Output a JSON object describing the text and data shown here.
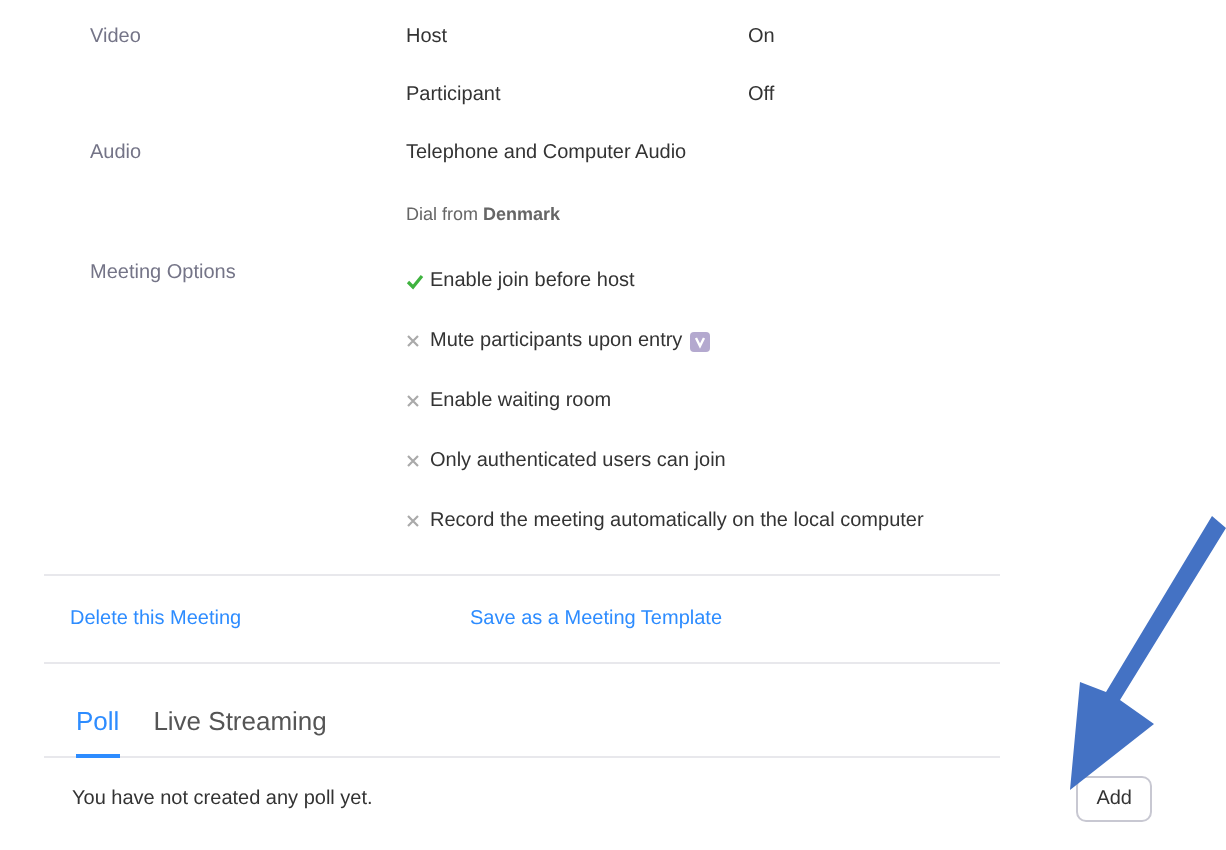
{
  "settings": [
    {
      "label": "Video",
      "rows": [
        {
          "name": "Host",
          "value": "On"
        },
        {
          "name": "Participant",
          "value": "Off"
        }
      ]
    },
    {
      "label": "Audio",
      "rows": [
        {
          "name": "Telephone and Computer Audio"
        },
        {
          "name": "Dial from **Denmark**",
          "kind": "note"
        }
      ]
    }
  ],
  "meeting_options": {
    "label": "Meeting Options",
    "options": [
      {
        "text": "Enable join before host",
        "checked": true,
        "badge": false
      },
      {
        "text": "Mute participants upon entry",
        "checked": false,
        "badge": true
      },
      {
        "text": "Enable waiting room",
        "checked": false,
        "badge": false
      },
      {
        "text": "Only authenticated users can join",
        "checked": false,
        "badge": false
      },
      {
        "text": "Record the meeting automatically on the local computer",
        "checked": false,
        "badge": false
      }
    ]
  },
  "actions": [
    "Delete this Meeting",
    "Save as a Meeting Template"
  ],
  "tabs": [
    {
      "label": "Poll",
      "selected": true
    },
    {
      "label": "Live Streaming",
      "selected": false
    }
  ],
  "empty_message": "You have not created any poll yet.",
  "add_button": "Add"
}
